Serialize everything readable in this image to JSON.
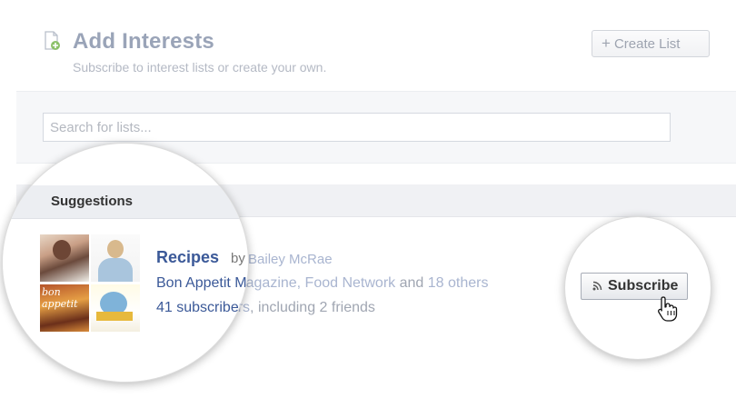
{
  "header": {
    "title": "Add Interests",
    "subtitle": "Subscribe to interest lists or create your own.",
    "create_list_label": "Create List",
    "icons": {
      "add": "add-interest-icon",
      "plus": "plus-icon"
    }
  },
  "search": {
    "placeholder": "Search for lists..."
  },
  "suggestions": {
    "heading": "Suggestions",
    "items": [
      {
        "title": "Recipes",
        "by_label": "by",
        "author": "Bailey McRae",
        "sources_links": "Bon Appetit Magazine, Food Network",
        "sources_and": "and",
        "sources_others": "18 others",
        "subscribers": "41 subscribers",
        "friends_text": ", including 2 friends",
        "subscribe_label": "Subscribe",
        "thumbnail_text": "bon appetit"
      }
    ]
  },
  "colors": {
    "link": "#3b5998",
    "title_gray": "#9aa4b8",
    "band": "#f6f7f9"
  }
}
